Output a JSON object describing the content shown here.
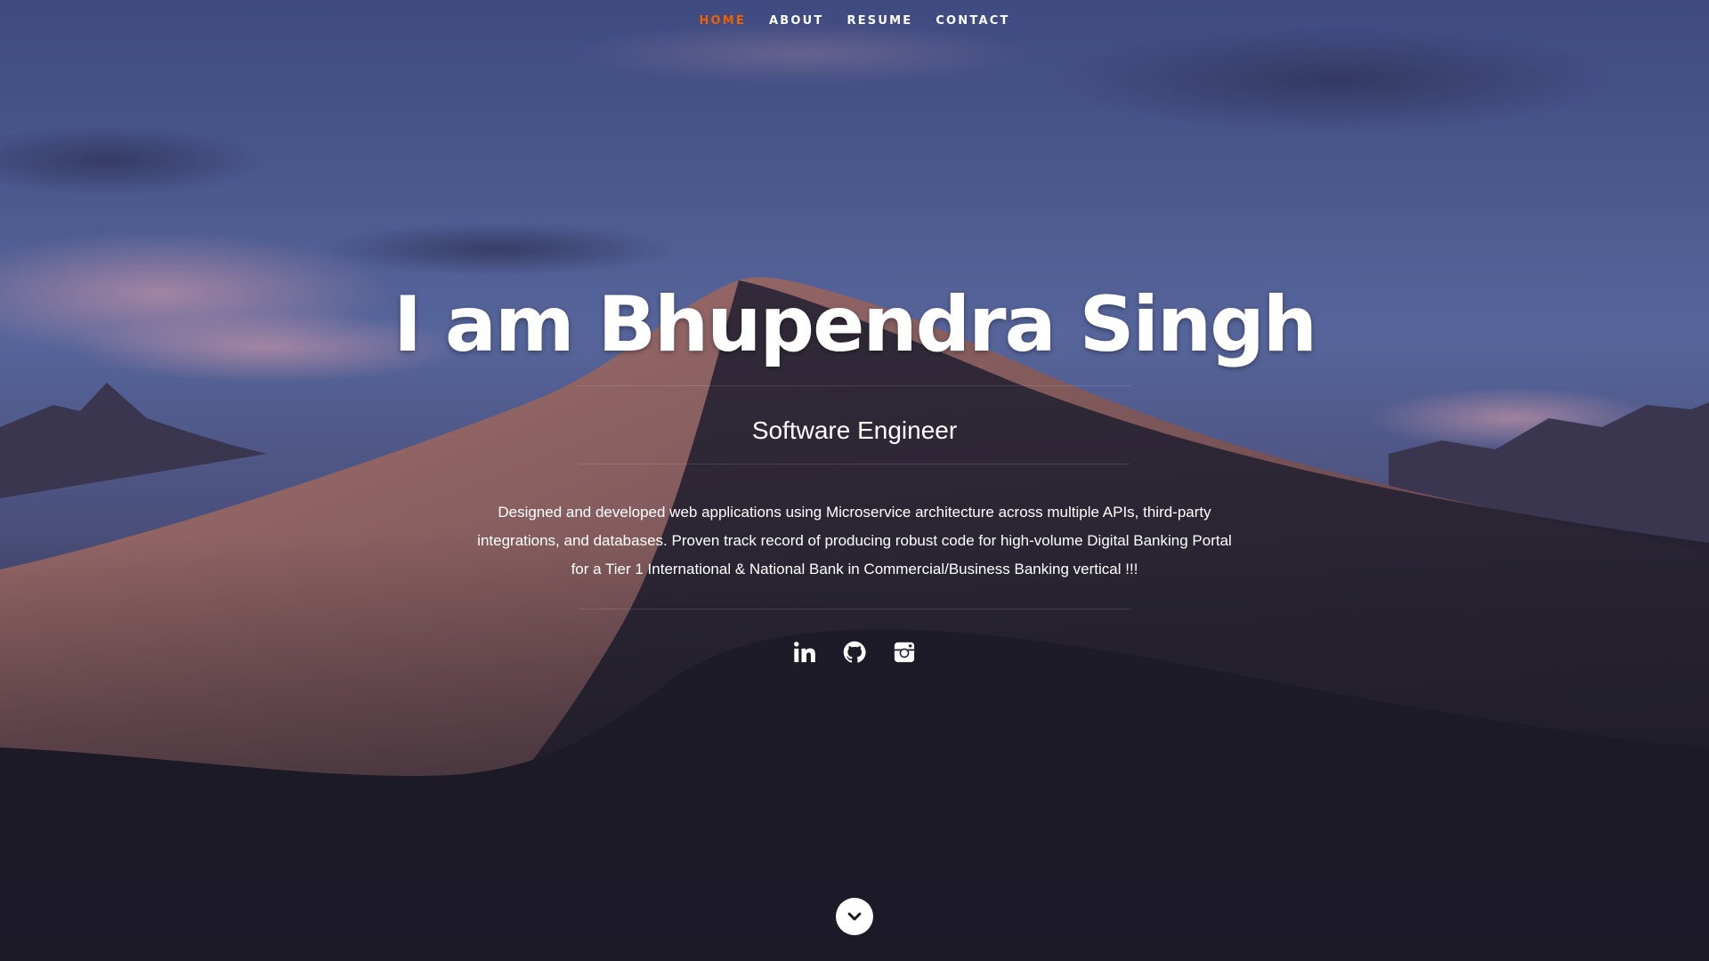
{
  "nav": {
    "items": [
      {
        "label": "Home",
        "active": true
      },
      {
        "label": "About",
        "active": false
      },
      {
        "label": "Resume",
        "active": false
      },
      {
        "label": "Contact",
        "active": false
      }
    ]
  },
  "banner": {
    "headline": "I am Bhupendra Singh",
    "subtitle": "Software Engineer",
    "description": "Designed and developed web applications using Microservice architecture across multiple APIs, third-party integrations, and databases. Proven track record of producing robust code for high-volume Digital Banking Portal for a Tier 1 International & National Bank in Commercial/Business Banking vertical !!!"
  },
  "social": [
    {
      "icon": "linkedin-icon"
    },
    {
      "icon": "github-icon"
    },
    {
      "icon": "instagram-icon"
    }
  ],
  "scroll": {
    "icon": "chevron-down-icon"
  },
  "colors": {
    "accent": "#F06000",
    "text": "#FFFFFF",
    "sky_top": "#3c4a7e",
    "dune": "#8a6266",
    "ground": "#1c1a27"
  }
}
